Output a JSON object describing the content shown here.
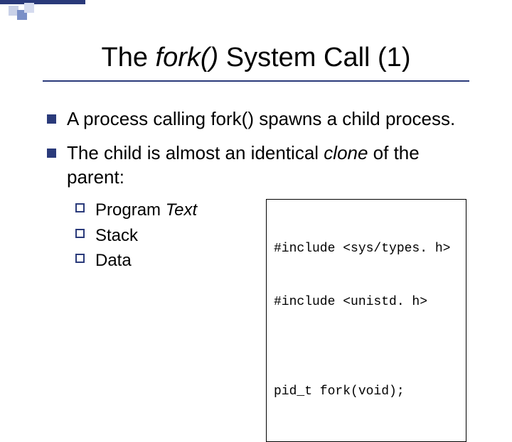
{
  "title": {
    "pre": "The ",
    "func": "fork()",
    "post": " System Call (1)"
  },
  "bullets": [
    {
      "text": "A process calling fork() spawns a child process."
    },
    {
      "pre": "The child is almost an identical ",
      "italic": "clone",
      "post": " of the parent:"
    }
  ],
  "sub": [
    {
      "label": "Program",
      "italic": " Text"
    },
    {
      "label": "Stack"
    },
    {
      "label": "Data"
    }
  ],
  "code": {
    "l1": "#include <sys/types. h>",
    "l2": "#include <unistd. h>",
    "l3": "",
    "l4": "pid_t fork(void);"
  }
}
